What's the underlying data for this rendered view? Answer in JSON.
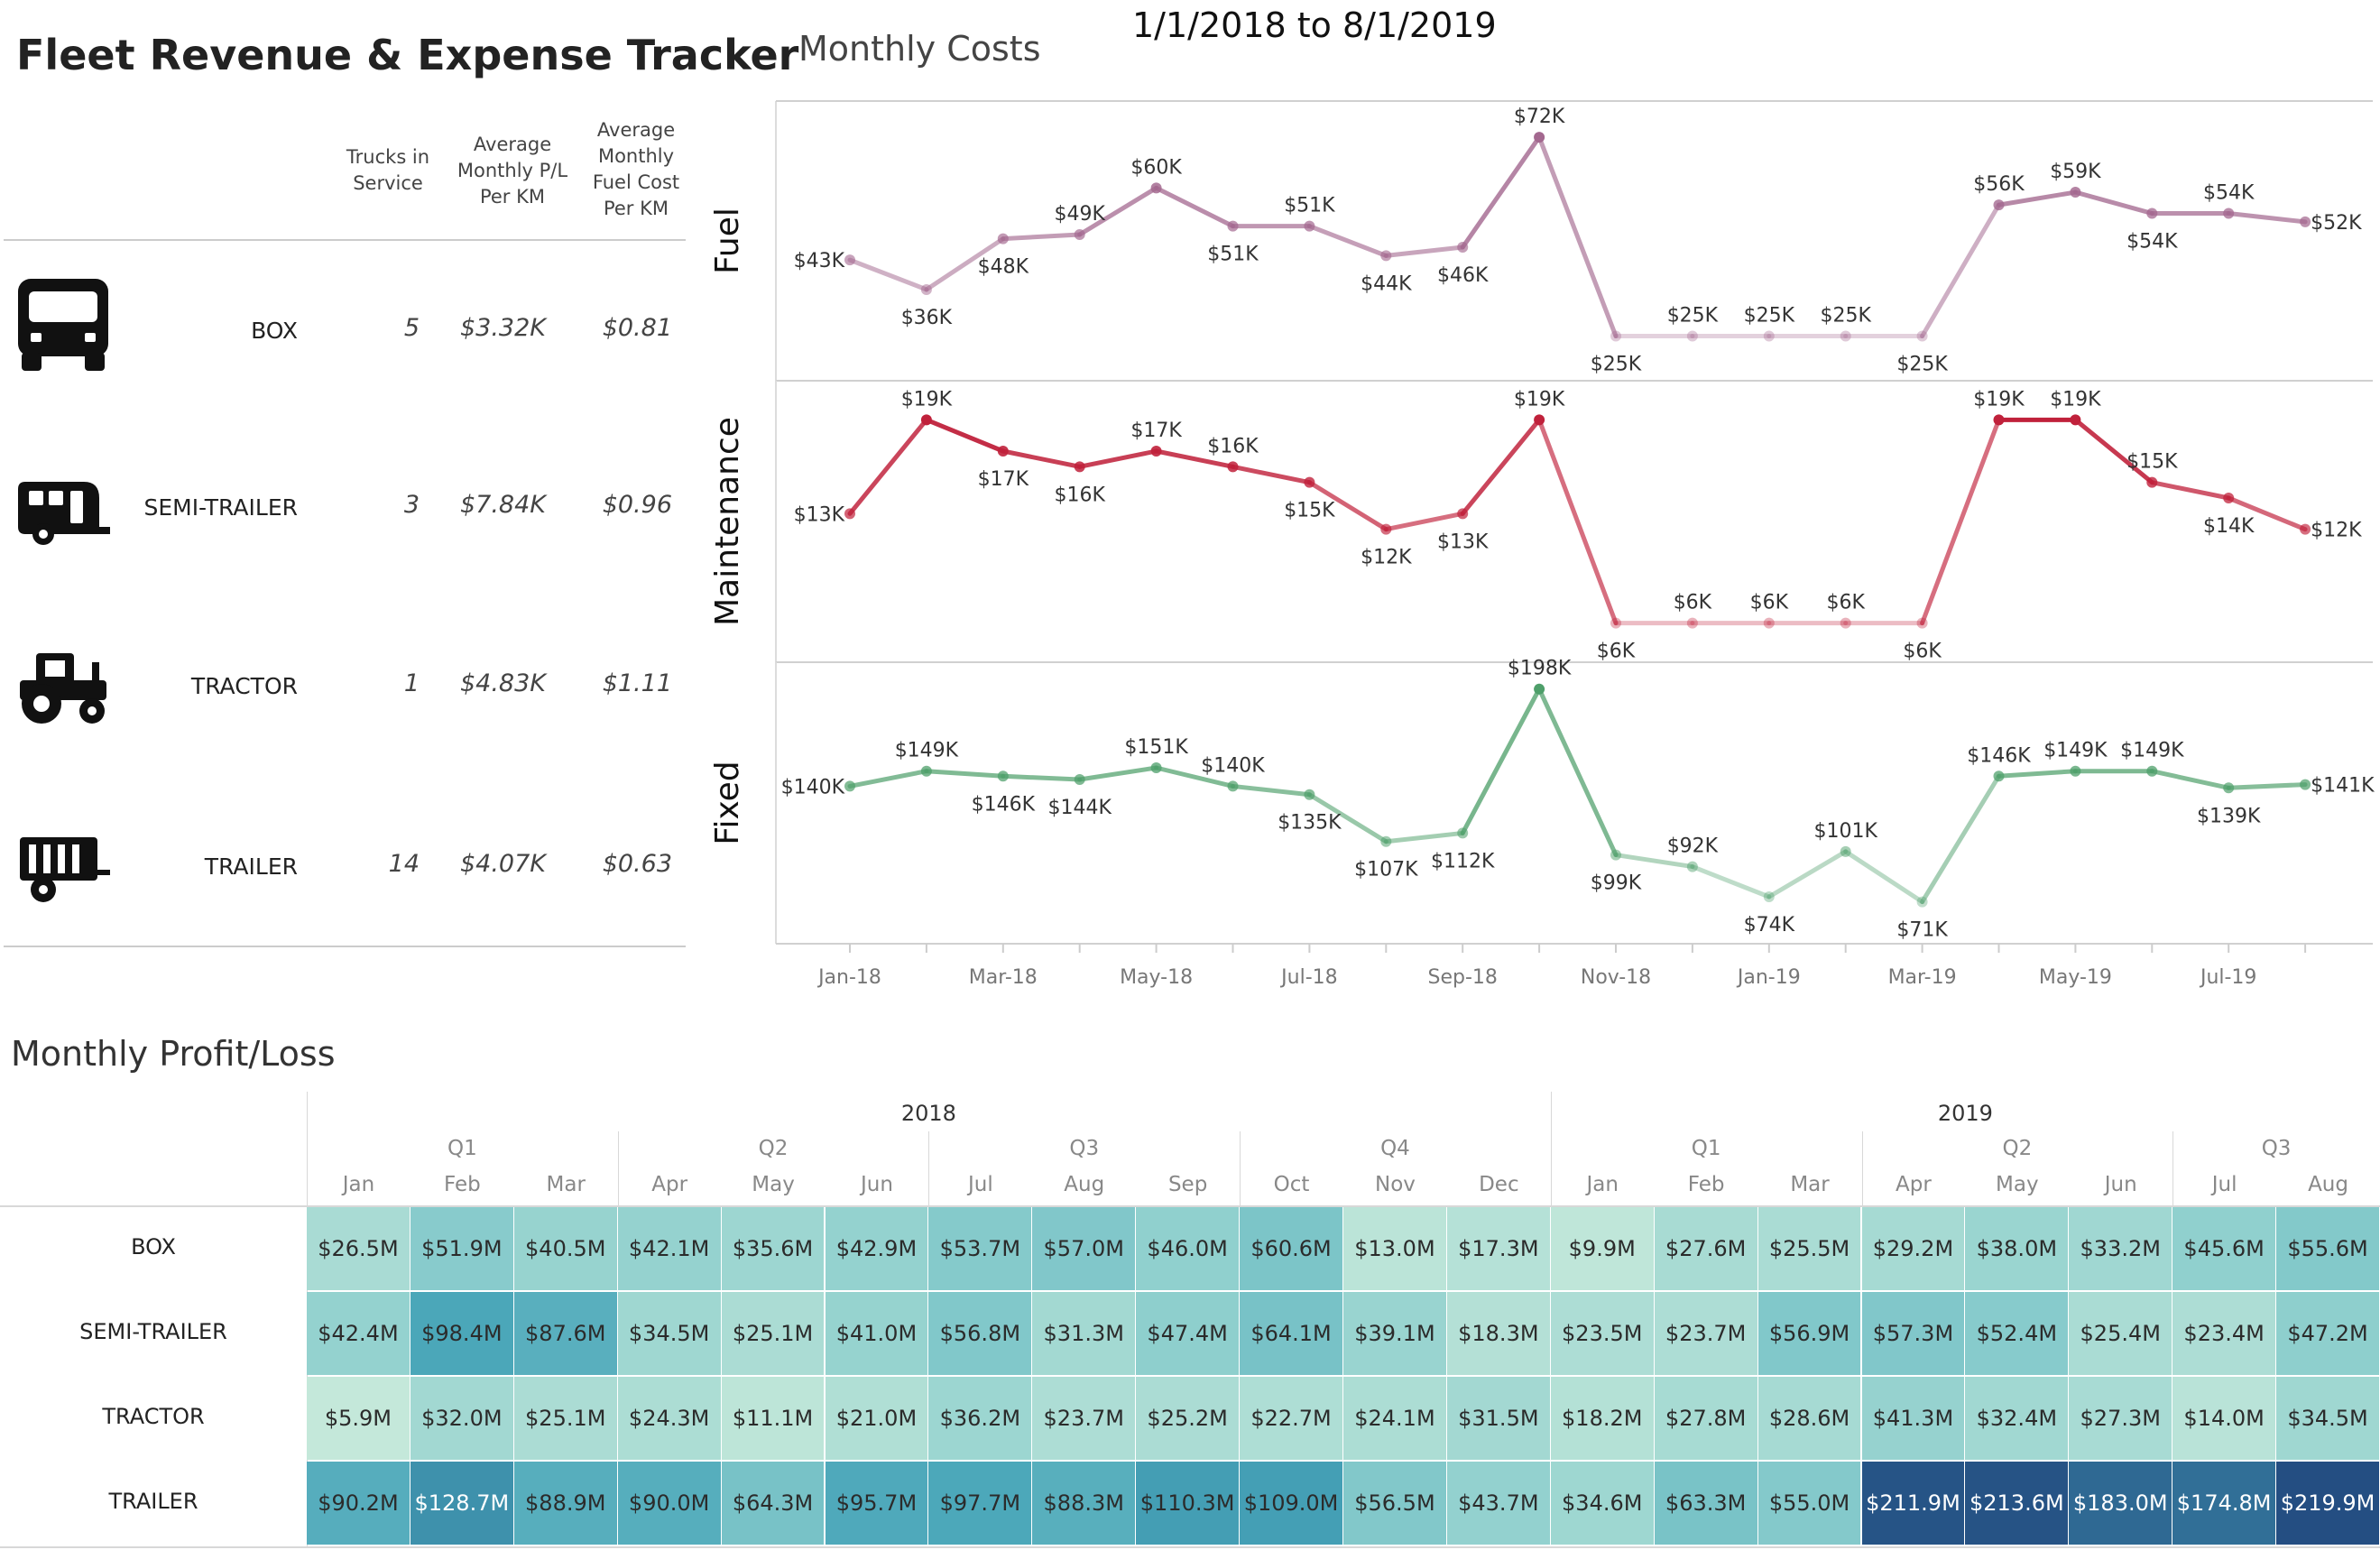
{
  "header": {
    "title": "Fleet Revenue & Expense Tracker",
    "date_range": "1/1/2018 to 8/1/2019"
  },
  "fleet_table": {
    "col_trucks": [
      "Trucks in",
      "Service"
    ],
    "col_pl": [
      "Average",
      "Monthly P/L",
      "Per KM"
    ],
    "col_fuel": [
      "Average",
      "Monthly",
      "Fuel Cost",
      "Per KM"
    ],
    "rows": [
      {
        "icon": "box-truck-icon",
        "name": "BOX",
        "trucks": "5",
        "pl": "$3.32K",
        "fuel": "$0.81"
      },
      {
        "icon": "semi-trailer-icon",
        "name": "SEMI-TRAILER",
        "trucks": "3",
        "pl": "$7.84K",
        "fuel": "$0.96"
      },
      {
        "icon": "tractor-icon",
        "name": "TRACTOR",
        "trucks": "1",
        "pl": "$4.83K",
        "fuel": "$1.11"
      },
      {
        "icon": "trailer-icon",
        "name": "TRAILER",
        "trucks": "14",
        "pl": "$4.07K",
        "fuel": "$0.63"
      }
    ]
  },
  "costs": {
    "title": "Monthly Costs",
    "panel_labels": [
      "Fuel",
      "Maintenance",
      "Fixed"
    ],
    "x_ticks": [
      "Jan-18",
      "Mar-18",
      "May-18",
      "Jul-18",
      "Sep-18",
      "Nov-18",
      "Jan-19",
      "Mar-19",
      "May-19",
      "Jul-19"
    ]
  },
  "chart_data": {
    "type": "line",
    "x": [
      "Jan-18",
      "Feb-18",
      "Mar-18",
      "Apr-18",
      "May-18",
      "Jun-18",
      "Jul-18",
      "Aug-18",
      "Sep-18",
      "Oct-18",
      "Nov-18",
      "Dec-18",
      "Jan-19",
      "Feb-19",
      "Mar-19",
      "Apr-19",
      "May-19",
      "Jun-19",
      "Jul-19",
      "Aug-19"
    ],
    "series": [
      {
        "name": "Fuel",
        "color": "#a3688f",
        "values": [
          43,
          36,
          48,
          49,
          60,
          51,
          51,
          44,
          46,
          72,
          25,
          25,
          25,
          25,
          25,
          56,
          59,
          54,
          54,
          52
        ],
        "labels": [
          "$43K",
          "$36K",
          "$48K",
          "$49K",
          "$60K",
          "$51K",
          "$51K",
          "$44K",
          "$46K",
          "$72K",
          "$25K",
          "$25K",
          "$25K",
          "$25K",
          "$25K",
          "$56K",
          "$59K",
          "$54K",
          "$54K",
          "$52K"
        ],
        "ylim": [
          20,
          75
        ]
      },
      {
        "name": "Maintenance",
        "color": "#c0213b",
        "values": [
          13,
          19,
          17,
          16,
          17,
          16,
          15,
          12,
          13,
          19,
          6,
          6,
          6,
          6,
          6,
          19,
          19,
          15,
          14,
          12
        ],
        "labels": [
          "$13K",
          "$19K",
          "$17K",
          "$16K",
          "$17K",
          "$16K",
          "$15K",
          "$12K",
          "$13K",
          "$19K",
          "$6K",
          "$6K",
          "$6K",
          "$6K",
          "$6K",
          "$19K",
          "$19K",
          "$15K",
          "$14K",
          "$12K"
        ],
        "ylim": [
          5,
          20
        ]
      },
      {
        "name": "Fixed",
        "color": "#4e9f6a",
        "values": [
          140,
          149,
          146,
          144,
          151,
          140,
          135,
          107,
          112,
          198,
          99,
          92,
          74,
          101,
          71,
          146,
          149,
          149,
          139,
          141
        ],
        "labels": [
          "$140K",
          "$149K",
          "$146K",
          "$144K",
          "$151K",
          "$140K",
          "$135K",
          "$107K",
          "$112K",
          "$198K",
          "$99K",
          "$92K",
          "$74K",
          "$101K",
          "$71K",
          "$146K",
          "$149K",
          "$149K",
          "$139K",
          "$141K"
        ],
        "ylim": [
          60,
          200
        ]
      }
    ]
  },
  "profit_loss": {
    "title": "Monthly Profit/Loss",
    "years": [
      "2018",
      "2019"
    ],
    "quarters": [
      "Q1",
      "Q2",
      "Q3",
      "Q4",
      "Q1",
      "Q2",
      "Q3"
    ],
    "months": [
      "Jan",
      "Feb",
      "Mar",
      "Apr",
      "May",
      "Jun",
      "Jul",
      "Aug",
      "Sep",
      "Oct",
      "Nov",
      "Dec",
      "Jan",
      "Feb",
      "Mar",
      "Apr",
      "May",
      "Jun",
      "Jul",
      "Aug"
    ],
    "rows": [
      {
        "name": "BOX",
        "values": [
          26.5,
          51.9,
          40.5,
          42.1,
          35.6,
          42.9,
          53.7,
          57.0,
          46.0,
          60.6,
          13.0,
          17.3,
          9.9,
          27.6,
          25.5,
          29.2,
          38.0,
          33.2,
          45.6,
          55.6
        ],
        "labels": [
          "$26.5M",
          "$51.9M",
          "$40.5M",
          "$42.1M",
          "$35.6M",
          "$42.9M",
          "$53.7M",
          "$57.0M",
          "$46.0M",
          "$60.6M",
          "$13.0M",
          "$17.3M",
          "$9.9M",
          "$27.6M",
          "$25.5M",
          "$29.2M",
          "$38.0M",
          "$33.2M",
          "$45.6M",
          "$55.6M"
        ]
      },
      {
        "name": "SEMI-TRAILER",
        "values": [
          42.4,
          98.4,
          87.6,
          34.5,
          25.1,
          41.0,
          56.8,
          31.3,
          47.4,
          64.1,
          39.1,
          18.3,
          23.5,
          23.7,
          56.9,
          57.3,
          52.4,
          25.4,
          23.4,
          47.2
        ],
        "labels": [
          "$42.4M",
          "$98.4M",
          "$87.6M",
          "$34.5M",
          "$25.1M",
          "$41.0M",
          "$56.8M",
          "$31.3M",
          "$47.4M",
          "$64.1M",
          "$39.1M",
          "$18.3M",
          "$23.5M",
          "$23.7M",
          "$56.9M",
          "$57.3M",
          "$52.4M",
          "$25.4M",
          "$23.4M",
          "$47.2M"
        ]
      },
      {
        "name": "TRACTOR",
        "values": [
          5.9,
          32.0,
          25.1,
          24.3,
          11.1,
          21.0,
          36.2,
          23.7,
          25.2,
          22.7,
          24.1,
          31.5,
          18.2,
          27.8,
          28.6,
          41.3,
          32.4,
          27.3,
          14.0,
          34.5
        ],
        "labels": [
          "$5.9M",
          "$32.0M",
          "$25.1M",
          "$24.3M",
          "$11.1M",
          "$21.0M",
          "$36.2M",
          "$23.7M",
          "$25.2M",
          "$22.7M",
          "$24.1M",
          "$31.5M",
          "$18.2M",
          "$27.8M",
          "$28.6M",
          "$41.3M",
          "$32.4M",
          "$27.3M",
          "$14.0M",
          "$34.5M"
        ]
      },
      {
        "name": "TRAILER",
        "values": [
          90.2,
          128.7,
          88.9,
          90.0,
          64.3,
          95.7,
          97.7,
          88.3,
          110.3,
          109.0,
          56.5,
          43.7,
          34.6,
          63.3,
          55.0,
          211.9,
          213.6,
          183.0,
          174.8,
          219.9
        ],
        "labels": [
          "$90.2M",
          "$128.7M",
          "$88.9M",
          "$90.0M",
          "$64.3M",
          "$95.7M",
          "$97.7M",
          "$88.3M",
          "$110.3M",
          "$109.0M",
          "$56.5M",
          "$43.7M",
          "$34.6M",
          "$63.3M",
          "$55.0M",
          "$211.9M",
          "$213.6M",
          "$183.0M",
          "$174.8M",
          "$219.9M"
        ]
      }
    ]
  }
}
